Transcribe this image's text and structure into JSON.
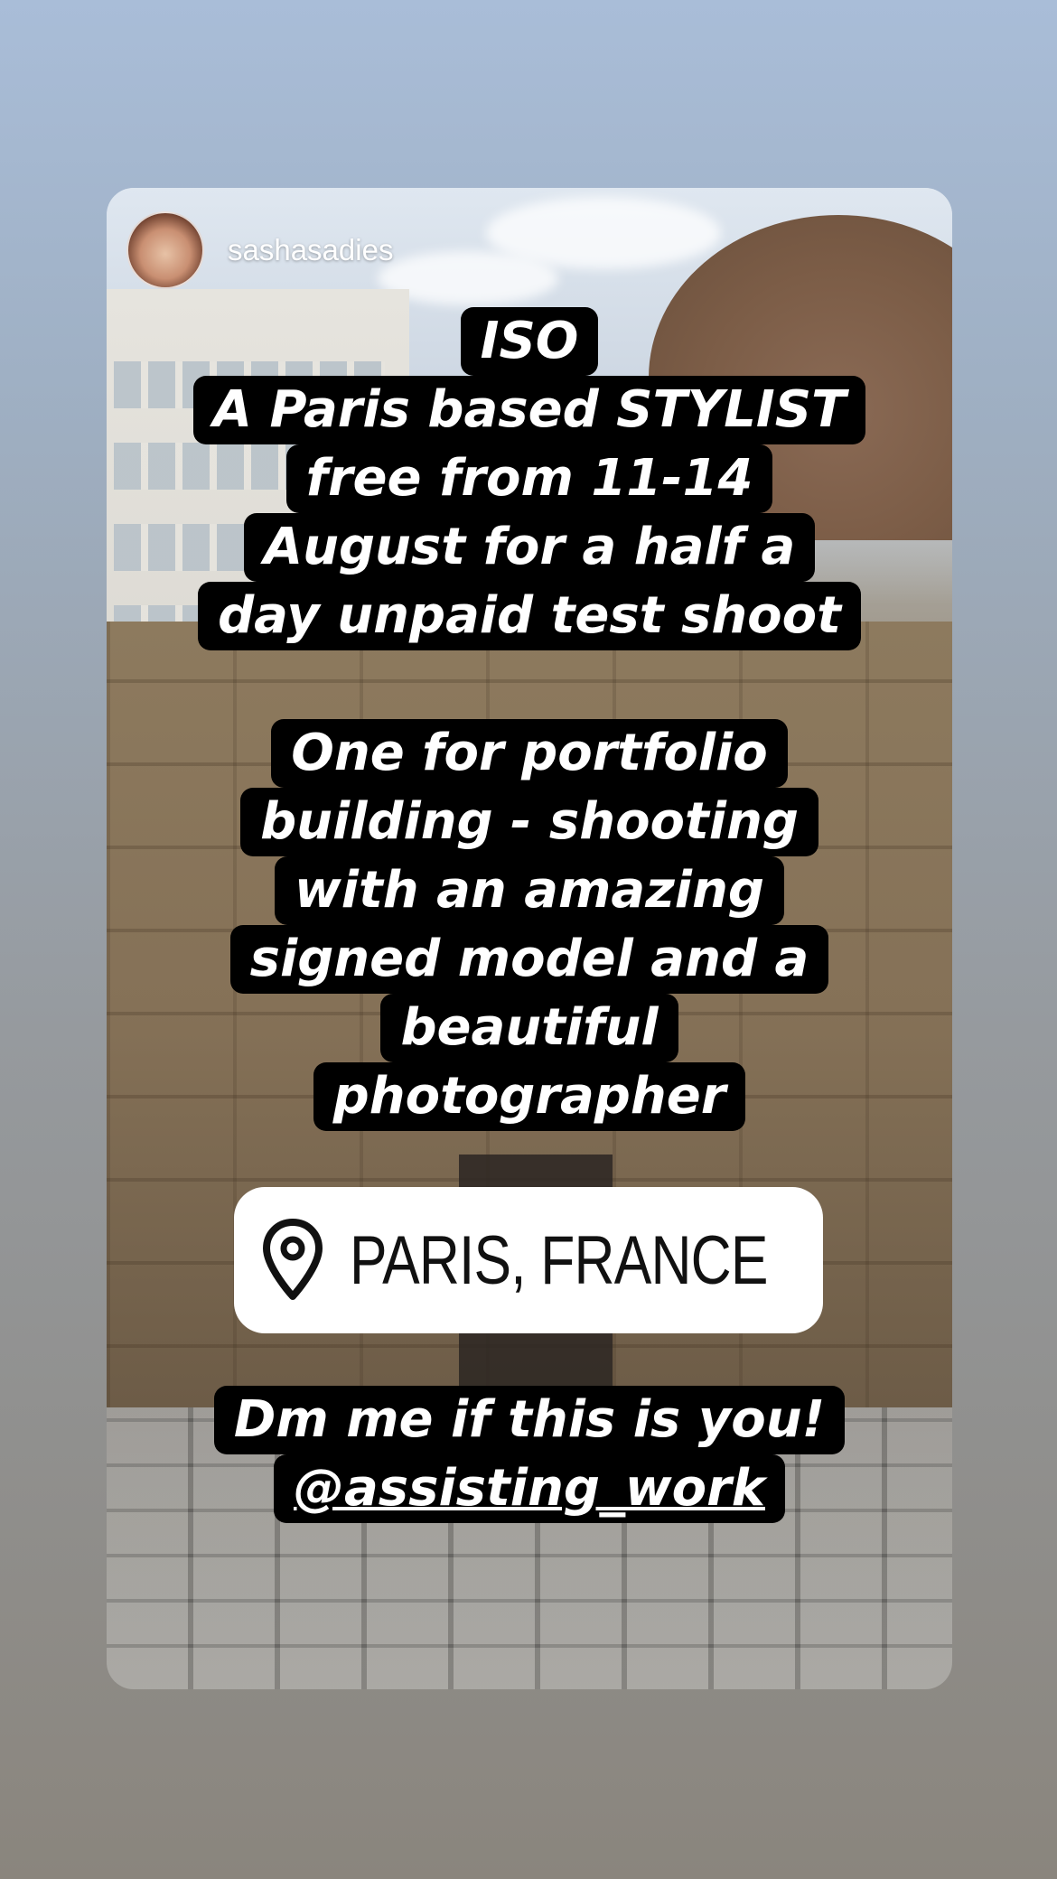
{
  "story": {
    "username": "sashasadies",
    "text_block_1": [
      "ISO",
      "A Paris based STYLIST",
      "free from 11-14",
      "August for a half a",
      "day unpaid test shoot"
    ],
    "text_block_2": [
      "One for portfolio",
      "building - shooting",
      "with an amazing",
      "signed model and a",
      "beautiful",
      "photographer"
    ],
    "location_sticker": {
      "icon": "location-pin-icon",
      "label": "PARIS, FRANCE"
    },
    "text_block_3": [
      "Dm me if this is you!"
    ],
    "mention": "@assisting_work"
  }
}
